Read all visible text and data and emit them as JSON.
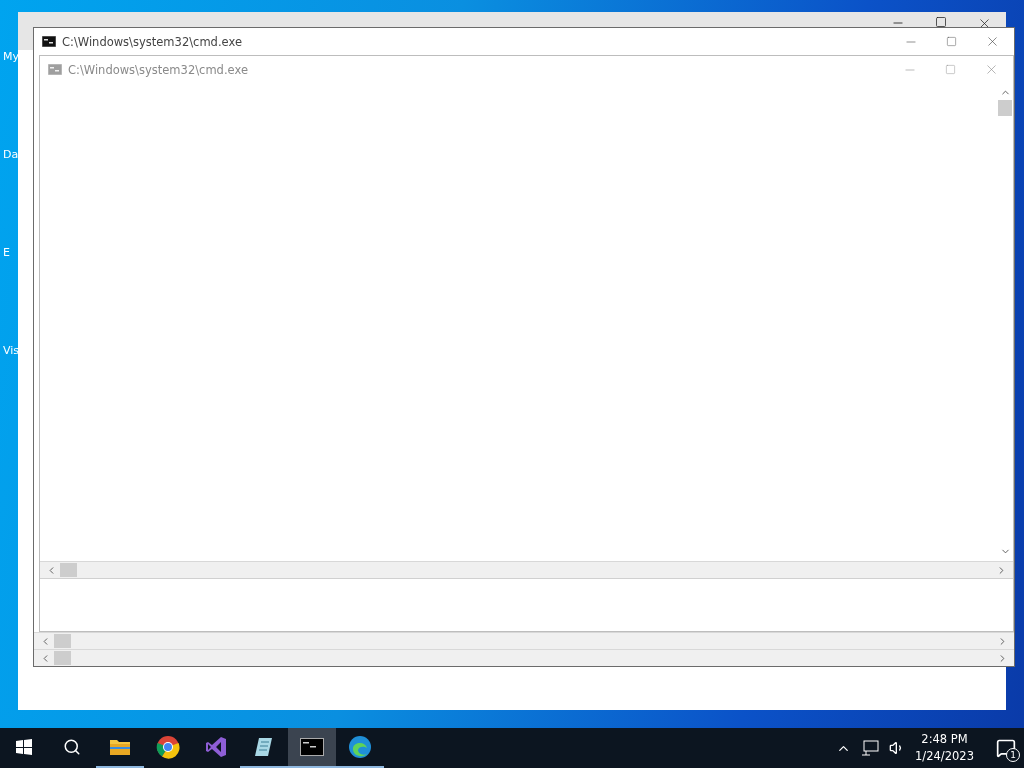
{
  "desktop_icons": [
    {
      "label": "My"
    },
    {
      "label": "Da"
    },
    {
      "label": "E"
    },
    {
      "label": "Vis"
    }
  ],
  "windows": [
    {
      "title": "C:\\Windows\\system32\\cmd.exe",
      "faded": false
    },
    {
      "title": "C:\\Windows\\system32\\cmd.exe",
      "faded": true
    }
  ],
  "taskbar": {
    "apps": [
      {
        "kind": "folder",
        "running": true,
        "selected": false
      },
      {
        "kind": "chrome",
        "running": false,
        "selected": false
      },
      {
        "kind": "studio",
        "running": false,
        "selected": false
      },
      {
        "kind": "notepad",
        "running": true,
        "selected": false
      },
      {
        "kind": "console",
        "running": true,
        "selected": true
      },
      {
        "kind": "edge",
        "running": true,
        "selected": false
      }
    ],
    "time": "2:48 PM",
    "date": "1/24/2023",
    "notification_count": "1"
  }
}
